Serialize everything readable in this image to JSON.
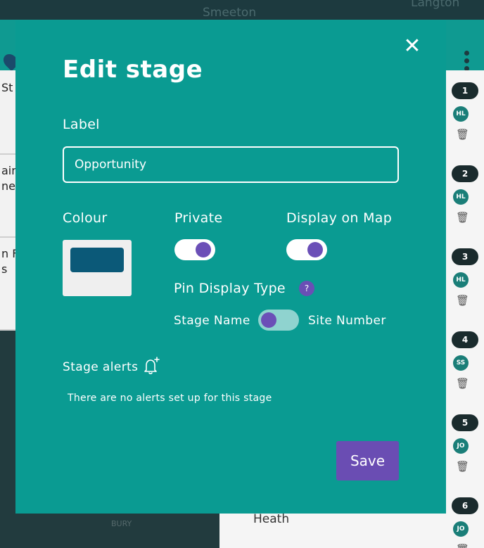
{
  "background": {
    "map_towns": [
      "Smeeton",
      "Langton"
    ],
    "left_cards": [
      "St",
      "ain\nnes",
      "n F\ns"
    ],
    "list_item": "Heath",
    "dark_panel_label": "BURY",
    "stages": [
      {
        "number": "1",
        "initials": "HL"
      },
      {
        "number": "2",
        "initials": "HL"
      },
      {
        "number": "3",
        "initials": "HL"
      },
      {
        "number": "4",
        "initials": "SS"
      },
      {
        "number": "5",
        "initials": "JO"
      },
      {
        "number": "6",
        "initials": "JO"
      }
    ]
  },
  "modal": {
    "title": "Edit stage",
    "close_icon": "close-icon",
    "label_heading": "Label",
    "label_value": "Opportunity",
    "colour_heading": "Colour",
    "colour_value": "#0b5978",
    "private_heading": "Private",
    "private_on": true,
    "display_on_map_heading": "Display on Map",
    "display_on_map_on": true,
    "pin_display_type_heading": "Pin Display Type",
    "help_glyph": "?",
    "pin_option_left": "Stage Name",
    "pin_option_right": "Site Number",
    "pin_display_type_value": "Stage Name",
    "stage_alerts_heading": "Stage alerts",
    "no_alerts_text": "There are no alerts set up for this stage",
    "save_label": "Save"
  },
  "colors": {
    "modal_bg": "#0a9b92",
    "accent_purple": "#6a4db3",
    "toggle_track_on": "#ffffff",
    "toggle_track_off": "#8fd3cf",
    "knob": "#6b4fb7"
  }
}
